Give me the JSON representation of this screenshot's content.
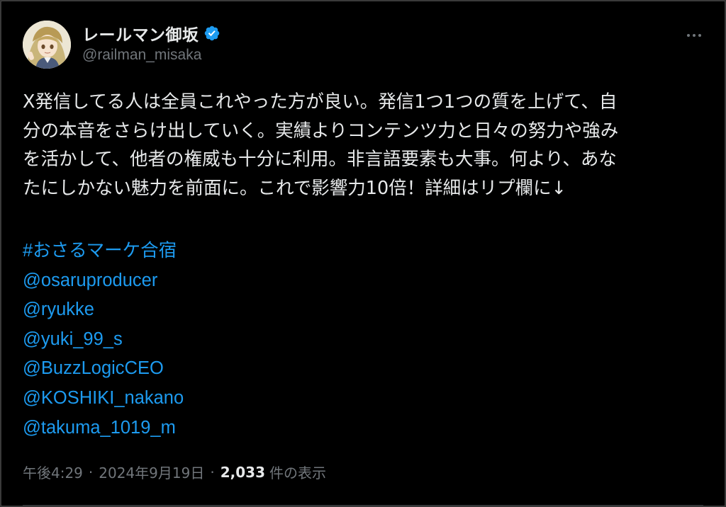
{
  "author": {
    "display_name": "レールマン御坂",
    "handle": "@railman_misaka",
    "verified_icon": "verified-badge-icon",
    "avatar_icon": "anime-character-avatar"
  },
  "menu": {
    "more_icon": "more-horizontal-icon"
  },
  "post": {
    "lines": [
      "X発信してる人は全員これやった方が良い。発信1つ1つの質を上げて、自",
      "分の本音をさらけ出していく。実績よりコンテンツ力と日々の努力や強み",
      "を活かして、他者の権威も十分に利用。非言語要素も大事。何より、あな",
      "たにしかない魅力を前面に。これで影響力10倍！詳細はリプ欄に↓"
    ],
    "hashtag": "#おさるマーケ合宿",
    "mentions": [
      "@osaruproducer",
      "@ryukke",
      "@yuki_99_s",
      "@BuzzLogicCEO",
      "@KOSHIKI_nakano",
      "@takuma_1019_m"
    ]
  },
  "meta": {
    "time": "午後4:29",
    "separator": "·",
    "date": "2024年9月19日",
    "views_count": "2,033",
    "views_label": "件の表示"
  },
  "colors": {
    "background": "#000000",
    "text": "#e7e9ea",
    "secondary": "#71767b",
    "link": "#1d9bf0"
  }
}
